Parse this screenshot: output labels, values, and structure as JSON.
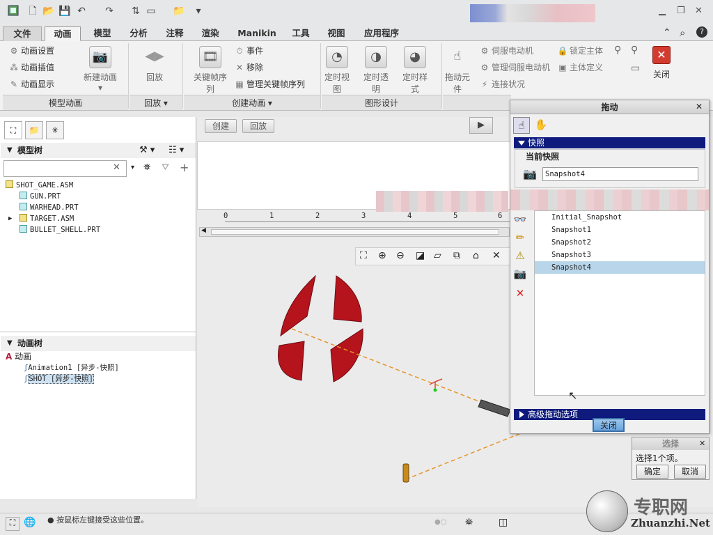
{
  "menu": {
    "file": "文件",
    "tabs": [
      "动画",
      "模型",
      "分析",
      "注释",
      "渲染",
      "Manikin",
      "工具",
      "视图",
      "应用程序"
    ]
  },
  "ribbon": {
    "model_anim": {
      "items": [
        "动画设置",
        "动画插值",
        "动画显示"
      ],
      "new_anim": "新建动画",
      "group": "模型动画"
    },
    "playback": {
      "label": "回放",
      "group": "回放"
    },
    "create": {
      "keyframe": "关键帧序列",
      "event": "事件",
      "remove": "移除",
      "manage": "管理关键帧序列",
      "group": "创建动画"
    },
    "graphic": {
      "view": "定时视图",
      "trans": "定时透明",
      "style": "定时样式",
      "group": "图形设计"
    },
    "mech": {
      "drag": "拖动元件",
      "servo": "伺服电动机",
      "manage_servo": "管理伺服电动机",
      "conn": "连接状况",
      "lock": "锁定主体",
      "body": "主体定义"
    },
    "close": "关闭"
  },
  "viewport": {
    "create_btn": "创建",
    "playback_btn": "回放",
    "ticks": [
      "0",
      "1",
      "2",
      "3",
      "4",
      "5",
      "6"
    ]
  },
  "model_tree": {
    "title": "模型树",
    "items": [
      "SHOT_GAME.ASM",
      "GUN.PRT",
      "WARHEAD.PRT",
      "TARGET.ASM",
      "BULLET_SHELL.PRT"
    ]
  },
  "anim_tree": {
    "title": "动画树",
    "root": "动画",
    "items": [
      "Animation1 [异步-快照]",
      "SHOT [异步-快照]"
    ]
  },
  "drag_dialog": {
    "title": "拖动",
    "snapshot_section": "快照",
    "current_label": "当前快照",
    "current_value": "Snapshot4",
    "snapshots": [
      "Initial_Snapshot",
      "Snapshot1",
      "Snapshot2",
      "Snapshot3",
      "Snapshot4"
    ],
    "advanced": "高级拖动选项",
    "close": "关闭"
  },
  "select_dialog": {
    "title": "选择",
    "text": "选择1个项。",
    "ok": "确定",
    "cancel": "取消"
  },
  "status": {
    "message": "● 按鼠标左键接受这些位置。"
  },
  "watermark": {
    "cn": "专职网",
    "en": "Zhuanzhi.Net"
  },
  "colors": {
    "accent": "#0e1b7d",
    "target_red": "#b5141c",
    "selection": "#b9d5ea"
  }
}
